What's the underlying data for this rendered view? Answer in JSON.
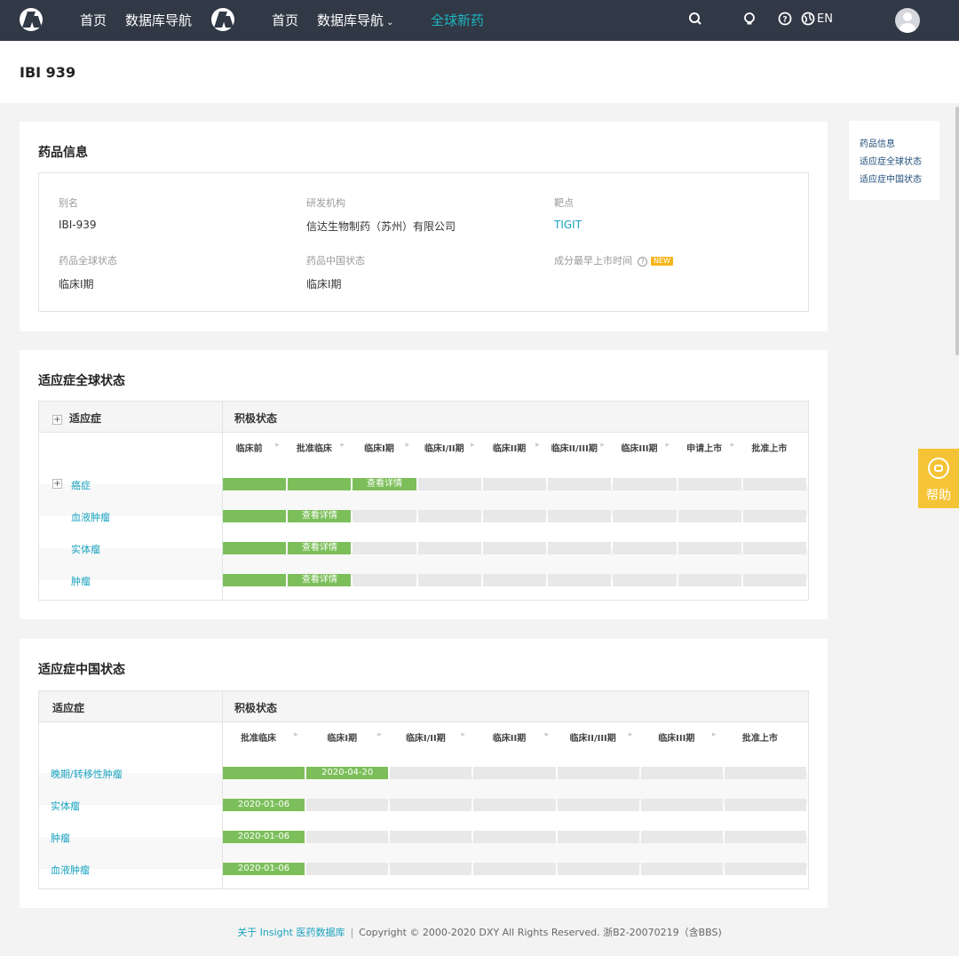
{
  "nav": {
    "home": "首页",
    "db_nav": "数据库导航",
    "home2": "首页",
    "db_nav2": "数据库导航",
    "global_new_drugs": "全球新药",
    "chevron": "⌄",
    "lang": "EN",
    "icons": [
      "search-icon",
      "bulb-icon",
      "help-icon",
      "globe-icon",
      "avatar"
    ]
  },
  "page": {
    "title": "IBI 939"
  },
  "drug_info": {
    "title": "药品信息",
    "fields": [
      {
        "label": "别名",
        "value": "IBI-939"
      },
      {
        "label": "研发机构",
        "value": "信达生物制药（苏州）有限公司"
      },
      {
        "label": "靶点",
        "value": "TIGIT"
      },
      {
        "label": "药品全球状态",
        "value": "临床I期"
      },
      {
        "label": "药品中国状态",
        "value": "临床I期"
      },
      {
        "label": "成分最早上市时间",
        "value": ""
      }
    ],
    "help_glyph": "?",
    "new_badge": "NEW"
  },
  "global_status": {
    "title": "适应症全球状态",
    "col_indication": "适应症",
    "col_status": "积极状态",
    "expand_glyph": "+",
    "arrow_glyph": "▸",
    "phases": [
      "临床前",
      "批准临床",
      "临床I期",
      "临床I/II期",
      "临床II期",
      "临床II/III期",
      "临床III期",
      "申请上市",
      "批准上市"
    ],
    "rows": [
      {
        "name": "癌症",
        "expandable": true,
        "filled": 2,
        "label": "查看详情"
      },
      {
        "name": "血液肿瘤",
        "expandable": false,
        "filled": 1,
        "label": "查看详情"
      },
      {
        "name": "实体瘤",
        "expandable": false,
        "filled": 1,
        "label": "查看详情"
      },
      {
        "name": "肿瘤",
        "expandable": false,
        "filled": 1,
        "label": "查看详情"
      }
    ]
  },
  "china_status": {
    "title": "适应症中国状态",
    "col_indication": "适应症",
    "col_status": "积极状态",
    "arrow_glyph": "▸",
    "phases": [
      "批准临床",
      "临床I期",
      "临床I/II期",
      "临床II期",
      "临床II/III期",
      "临床III期",
      "批准上市"
    ],
    "rows": [
      {
        "name": "晚期/转移性肿瘤",
        "filled": 1,
        "label": "2020-04-20"
      },
      {
        "name": "实体瘤",
        "filled": 0,
        "label": "2020-01-06"
      },
      {
        "name": "肿瘤",
        "filled": 0,
        "label": "2020-01-06"
      },
      {
        "name": "血液肿瘤",
        "filled": 0,
        "label": "2020-01-06"
      }
    ]
  },
  "anchor_nav": [
    "药品信息",
    "适应症全球状态",
    "适应症中国状态"
  ],
  "help_float": {
    "label": "帮助"
  },
  "footer": {
    "link": "关于 Insight 医药数据库",
    "sep": "|",
    "copyright": "Copyright © 2000-2020 DXY All Rights Reserved. 浙B2-20070219（含BBS)"
  },
  "colors": {
    "nav_bg": "#313846",
    "accent": "#1eb5c0",
    "bar_green": "#7cbf5a",
    "help_yellow": "#f5c436"
  }
}
